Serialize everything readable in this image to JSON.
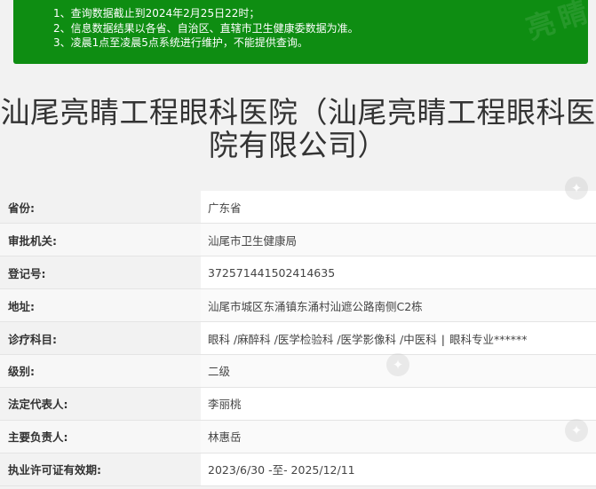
{
  "notice": {
    "lines": [
      "1、查询数据截止到2024年2月25日22时；",
      "2、信息数据结果以各省、自治区、直辖市卫生健康委数据为准。",
      "3、凌晨1点至凌晨5点系统进行维护，不能提供查询。"
    ]
  },
  "title": {
    "line1": "汕尾亮睛工程眼科医院（汕尾亮睛工程眼科医",
    "line2": "院有限公司）"
  },
  "rows": [
    {
      "label": "省份:",
      "value": "广东省"
    },
    {
      "label": "审批机关:",
      "value": "汕尾市卫生健康局"
    },
    {
      "label": "登记号:",
      "value": "372571441502414635"
    },
    {
      "label": "地址:",
      "value": "汕尾市城区东涌镇东涌村汕遮公路南侧C2栋"
    },
    {
      "label": "诊疗科目:",
      "value": "眼科 /麻醉科 /医学检验科 /医学影像科 /中医科",
      "separator": "|",
      "value_extra": "眼科专业******"
    },
    {
      "label": "级别:",
      "value": "二级"
    },
    {
      "label": "法定代表人:",
      "value": "李丽桃"
    },
    {
      "label": "主要负责人:",
      "value": "林惠岳"
    },
    {
      "label": "执业许可证有效期:",
      "value": "2023/6/30 -至- 2025/12/11"
    }
  ],
  "colors": {
    "notice_bg": "#0e8d12",
    "page_bg": "#f2f2f2",
    "value_bg": "#ffffff"
  }
}
